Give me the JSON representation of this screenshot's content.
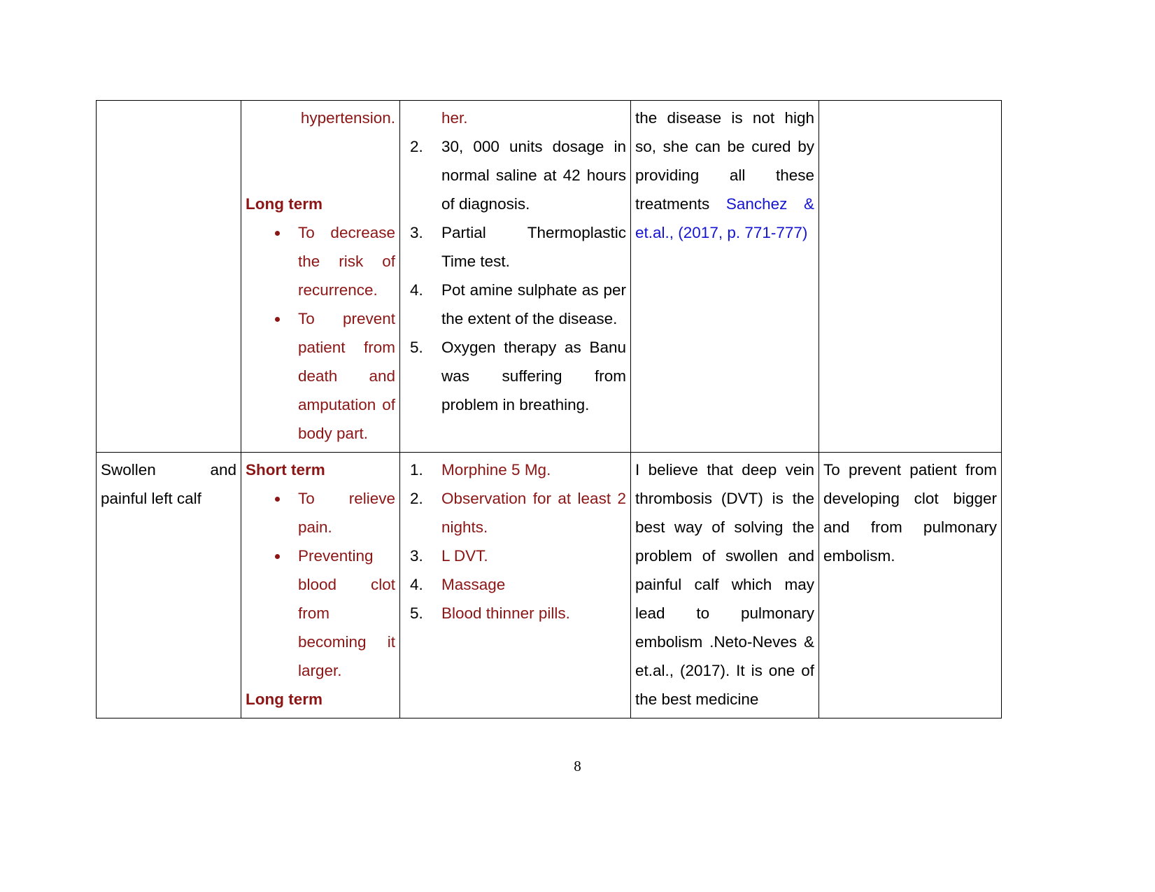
{
  "document": {
    "page_number": "8",
    "colors": {
      "body_text": "#000000",
      "highlight_maroon": "#8c1515",
      "citation_blue": "#1414d2",
      "border": "#000000"
    }
  },
  "table": {
    "rows": [
      {
        "id": "row-1-continued",
        "col1_assessment": "",
        "col2_goals": {
          "continued_line": "hypertension.",
          "heading": "Long term",
          "bullets": [
            "To decrease the risk of recurrence.",
            "To prevent patient from death and amputation of body part."
          ]
        },
        "col3_interventions": {
          "continued_line": "her.",
          "items": [
            "30, 000 units dosage in normal saline at 42 hours of diagnosis.",
            "Partial Thermoplastic Time test.",
            "Pot amine sulphate as per the extent of the disease.",
            "Oxygen therapy as Banu was suffering from problem in breathing."
          ],
          "start_number": 2
        },
        "col4_rationale": {
          "text_black": "the disease is not high so, she can be cured by providing all these treatments ",
          "citation": "Sanchez & et.al., (2017, p. 771-777)"
        },
        "col5_evaluation": ""
      },
      {
        "id": "row-2",
        "col1_assessment": "Swollen and painful left calf",
        "col2_goals": {
          "heading_short": "Short term",
          "bullets": [
            "To relieve pain.",
            "Preventing blood clot from becoming it larger."
          ],
          "heading_long": "Long term"
        },
        "col3_interventions": {
          "items": [
            "Morphine 5 Mg.",
            "Observation for at least 2 nights.",
            "L DVT.",
            "Massage",
            "Blood thinner pills."
          ],
          "start_number": 1
        },
        "col4_rationale": {
          "text_black": "I believe that deep vein thrombosis (DVT) is the best way of solving the problem of swollen and painful calf which may lead to pulmonary embolism .Neto-Neves & et.al., (2017). It is one of the best medicine"
        },
        "col5_evaluation": "To prevent patient from developing clot bigger and from pulmonary embolism."
      }
    ]
  }
}
